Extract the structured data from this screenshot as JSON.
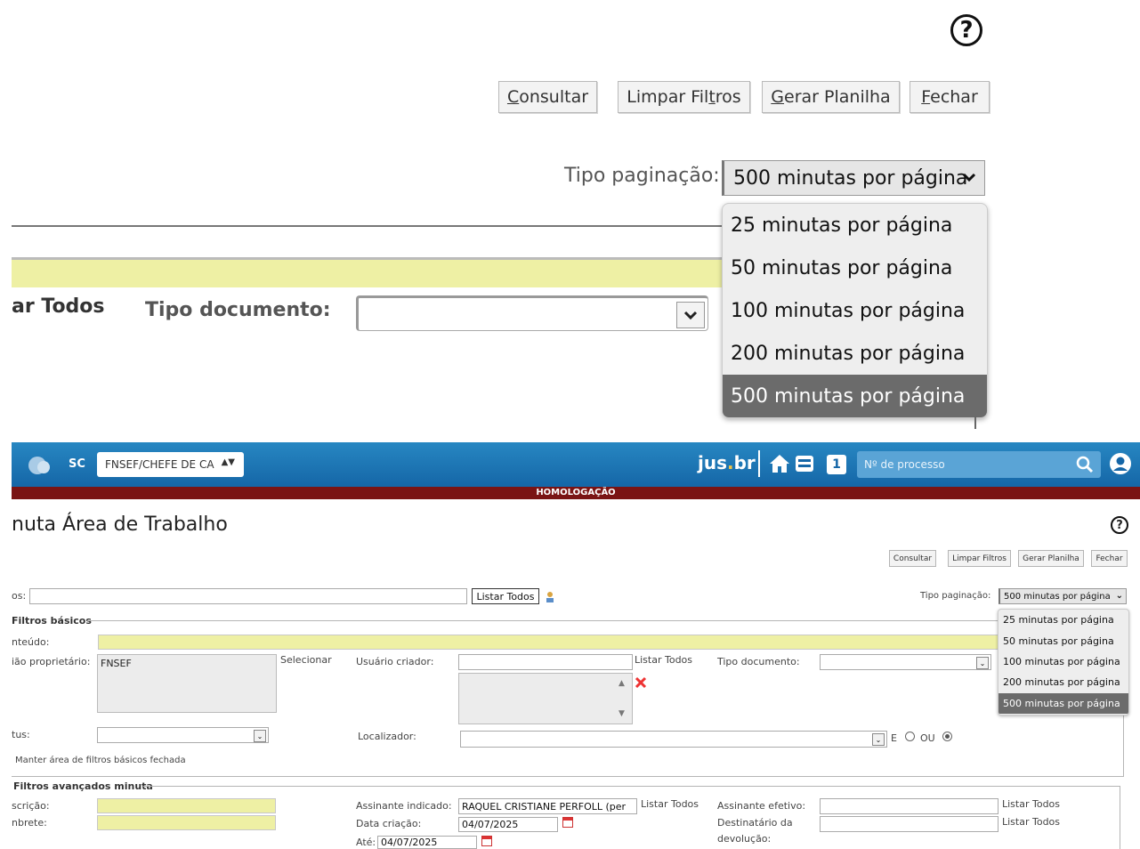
{
  "zoom": {
    "help_glyph": "?",
    "buttons": {
      "consultar": {
        "pre": "",
        "key": "C",
        "post": "onsultar"
      },
      "limpar": {
        "pre": "Limpar Fil",
        "key": "t",
        "post": "ros"
      },
      "gerar": {
        "pre": "",
        "key": "G",
        "post": "erar Planilha"
      },
      "fechar": {
        "pre": "",
        "key": "F",
        "post": "echar"
      }
    },
    "tipo_paginacao_label": "Tipo paginação:",
    "selected": "500 minutas por página",
    "options": [
      "25 minutas por página",
      "50 minutas por página",
      "100 minutas por página",
      "200 minutas por página",
      "500 minutas por página"
    ],
    "listar_todos_partial": "ar Todos",
    "tipo_documento_label": "Tipo documento:"
  },
  "header": {
    "sc": "SC",
    "org_select": "FNSEF/CHEFE DE CA",
    "brand_a": "jus",
    "brand_dot": ".",
    "brand_b": "br",
    "badge": "1",
    "process_placeholder": "Nº de processo",
    "environment": "HOMOLOGAÇÃO"
  },
  "page": {
    "title": "nuta Área de Trabalho",
    "buttons": [
      "Consultar",
      "Limpar Filtros",
      "Gerar Planilha",
      "Fechar"
    ],
    "row1": {
      "label_partial": "os:",
      "listar_todos": "Listar Todos",
      "tipo_label": "Tipo paginação:",
      "tipo_value": "500 minutas por página"
    },
    "filtros_basicos": "Filtros básicos",
    "conteudo_label": "nteúdo:",
    "orgao_label": "ião proprietário:",
    "orgao_value": "FNSEF",
    "selecionar": "Selecionar",
    "usuario_label": "Usuário criador:",
    "usuario_listar": "Listar Todos",
    "tipo_doc_label": "Tipo documento:",
    "status_label": "tus:",
    "localizador_label": "Localizador:",
    "e_label": "E",
    "ou_label": "OU",
    "manter": "Manter área de filtros básicos fechada",
    "filtros_avancados": "Filtros avançados minuta",
    "descricao_label": "scrição:",
    "lembrete_label": "nbrete:",
    "assinante_ind_label": "Assinante indicado:",
    "assinante_ind_value": "RAQUEL CRISTIANE PERFOLL (per",
    "assinante_listar": "Listar Todos",
    "data_criacao_label": "Data criação:",
    "data_criacao_value": "04/07/2025",
    "ate_label": "Até:",
    "ate_value": "04/07/2025",
    "assinante_ef_label": "Assinante efetivo:",
    "assinante_ef_listar": "Listar Todos",
    "destinatario_label_1": "Destinatário da",
    "destinatario_label_2": "devolução:",
    "destinatario_listar": "Listar Todos"
  }
}
